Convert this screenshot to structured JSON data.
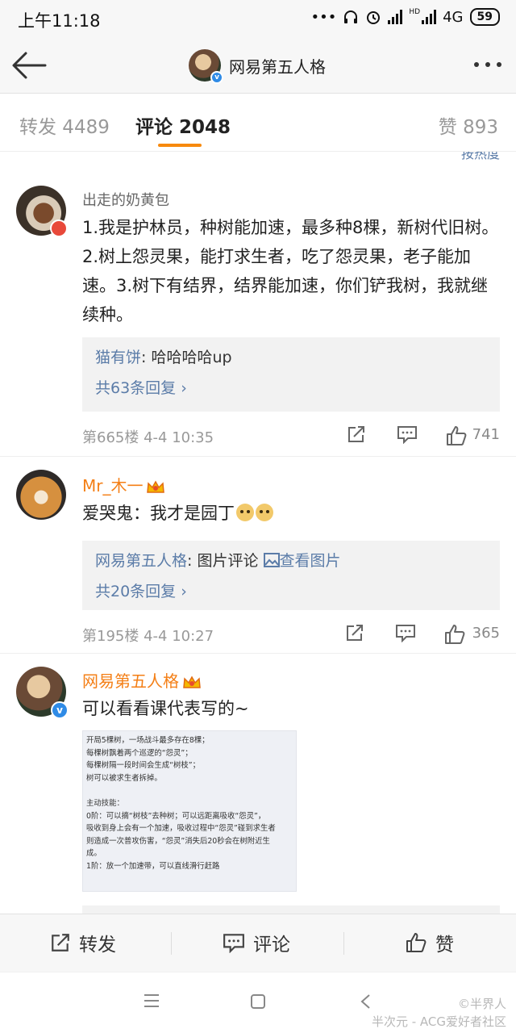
{
  "status_bar": {
    "time": "上午11:18",
    "dots": "•••",
    "network": "4G",
    "battery": "59",
    "hd": "HD"
  },
  "nav": {
    "title": "网易第五人格"
  },
  "tabs": [
    {
      "label": "转发 4489"
    },
    {
      "label": "评论 2048"
    },
    {
      "label": "赞 893"
    }
  ],
  "sort_hint": "按热度",
  "comments": [
    {
      "user": "出走的奶黄包",
      "text": "1.我是护林员，种树能加速，最多种8棵，新树代旧树。2.树上怨灵果，能打求生者，吃了怨灵果，老子能加速。3.树下有结界，结界能加速，你们铲我树，我就继续种。",
      "reply_author": "猫有饼",
      "reply_text": ": 哈哈哈哈up",
      "reply_more": "共63条回复 ›",
      "meta": "第665楼 4-4 10:35",
      "likes": "741"
    },
    {
      "user": "Mr_木一",
      "text": "爱哭鬼：我才是园丁",
      "reply_author": "网易第五人格",
      "reply_text": ": 图片评论",
      "reply_link": "查看图片",
      "reply_more": "共20条回复 ›",
      "meta": "第195楼 4-4 10:27",
      "likes": "365"
    },
    {
      "user": "网易第五人格",
      "text": "可以看看课代表写的~",
      "image_lines": [
        "开局5棵树，一场战斗最多存在8棵；",
        "每棵树飘着两个巡逻的“怨灵”；",
        "每棵树隔一段时间会生成“树枝”；",
        "树可以被求生者拆掉。",
        "",
        "主动技能：",
        "0阶：可以摘“树枝”去种树；可以远距离吸收“怨灵”，",
        "吸收到身上会有一个加速，吸收过程中“怨灵”碰到求生者",
        "则造成一次普攻伤害，“怨灵”消失后20秒会在树附近生",
        "成。",
        "1阶：放一个加速带，可以直线滑行赶路"
      ]
    }
  ],
  "actions": {
    "repost": "转发",
    "comment": "评论",
    "like": "赞"
  },
  "watermark": {
    "line1": "©半界人",
    "line2": "半次元 - ACG爱好者社区"
  }
}
